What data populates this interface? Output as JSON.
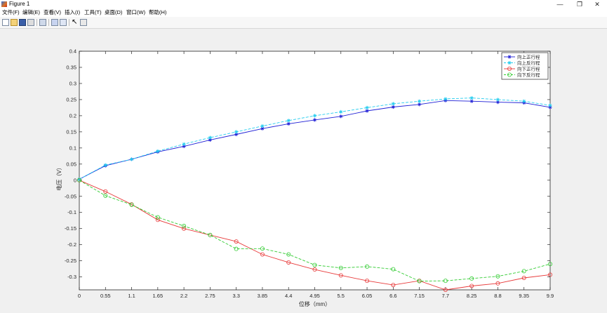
{
  "window": {
    "title": "Figure 1",
    "minimize": "—",
    "maximize": "❐",
    "close": "✕"
  },
  "menu": [
    "文件(F)",
    "编辑(E)",
    "查看(V)",
    "插入(I)",
    "工具(T)",
    "桌面(D)",
    "窗口(W)",
    "帮助(H)"
  ],
  "toolbar_icons": [
    "new-figure-icon",
    "open-file-icon",
    "save-icon",
    "print-icon",
    "link-plot-icon",
    "colorbar-icon",
    "legend-icon",
    "pointer-icon",
    "panel-icon"
  ],
  "axes_toolbar_icons": [
    "brush-icon",
    "data-tips-icon",
    "export-icon",
    "pan-icon",
    "zoom-in-icon",
    "zoom-out-icon",
    "home-icon"
  ],
  "chart_data": {
    "type": "line",
    "title": "",
    "xlabel": "位移（mm）",
    "ylabel": "电压（V）",
    "x": [
      0,
      0.55,
      1.1,
      1.65,
      2.2,
      2.75,
      3.3,
      3.85,
      4.4,
      4.95,
      5.5,
      6.05,
      6.6,
      7.15,
      7.7,
      8.25,
      8.8,
      9.35,
      9.9
    ],
    "xlim": [
      0,
      9.9
    ],
    "ylim": [
      -0.34,
      0.4
    ],
    "xticks": [
      "0",
      "0.55",
      "1.1",
      "1.65",
      "2.2",
      "2.75",
      "3.3",
      "3.85",
      "4.4",
      "4.95",
      "5.5",
      "6.05",
      "6.6",
      "7.15",
      "7.7",
      "8.25",
      "8.8",
      "9.35",
      "9.9"
    ],
    "yticks": [
      "0.4",
      "0.35",
      "0.3",
      "0.25",
      "0.2",
      "0.15",
      "0.1",
      "0.05",
      "0",
      "-0.05",
      "-0.1",
      "-0.15",
      "-0.2",
      "-0.25",
      "-0.3"
    ],
    "ytick_values": [
      0.4,
      0.35,
      0.3,
      0.25,
      0.2,
      0.15,
      0.1,
      0.05,
      0,
      -0.05,
      -0.1,
      -0.15,
      -0.2,
      -0.25,
      -0.3
    ],
    "grid": false,
    "legend_position": "top-right",
    "series": [
      {
        "name": "向上正行程",
        "color": "#1f1fd6",
        "dash": "solid",
        "marker": "star",
        "values": [
          0.003,
          0.045,
          0.065,
          0.088,
          0.105,
          0.125,
          0.142,
          0.16,
          0.175,
          0.187,
          0.198,
          0.215,
          0.227,
          0.235,
          0.247,
          0.245,
          0.242,
          0.24,
          0.226
        ]
      },
      {
        "name": "向上反行程",
        "color": "#22ccee",
        "dash": "dashed",
        "marker": "star",
        "values": [
          0.003,
          0.047,
          0.065,
          0.09,
          0.112,
          0.132,
          0.15,
          0.168,
          0.185,
          0.2,
          0.212,
          0.225,
          0.237,
          0.245,
          0.252,
          0.255,
          0.25,
          0.245,
          0.232
        ]
      },
      {
        "name": "向下正行程",
        "color": "#e83a3a",
        "dash": "solid",
        "marker": "circle",
        "values": [
          0.0,
          -0.035,
          -0.075,
          -0.123,
          -0.15,
          -0.17,
          -0.19,
          -0.23,
          -0.255,
          -0.277,
          -0.295,
          -0.312,
          -0.325,
          -0.312,
          -0.34,
          -0.328,
          -0.32,
          -0.303,
          -0.293
        ]
      },
      {
        "name": "向下反行程",
        "color": "#33cc33",
        "dash": "dashed",
        "marker": "circle",
        "values": [
          0.0,
          -0.048,
          -0.076,
          -0.115,
          -0.142,
          -0.17,
          -0.213,
          -0.212,
          -0.23,
          -0.263,
          -0.272,
          -0.268,
          -0.276,
          -0.313,
          -0.312,
          -0.305,
          -0.298,
          -0.282,
          -0.26
        ]
      }
    ]
  }
}
